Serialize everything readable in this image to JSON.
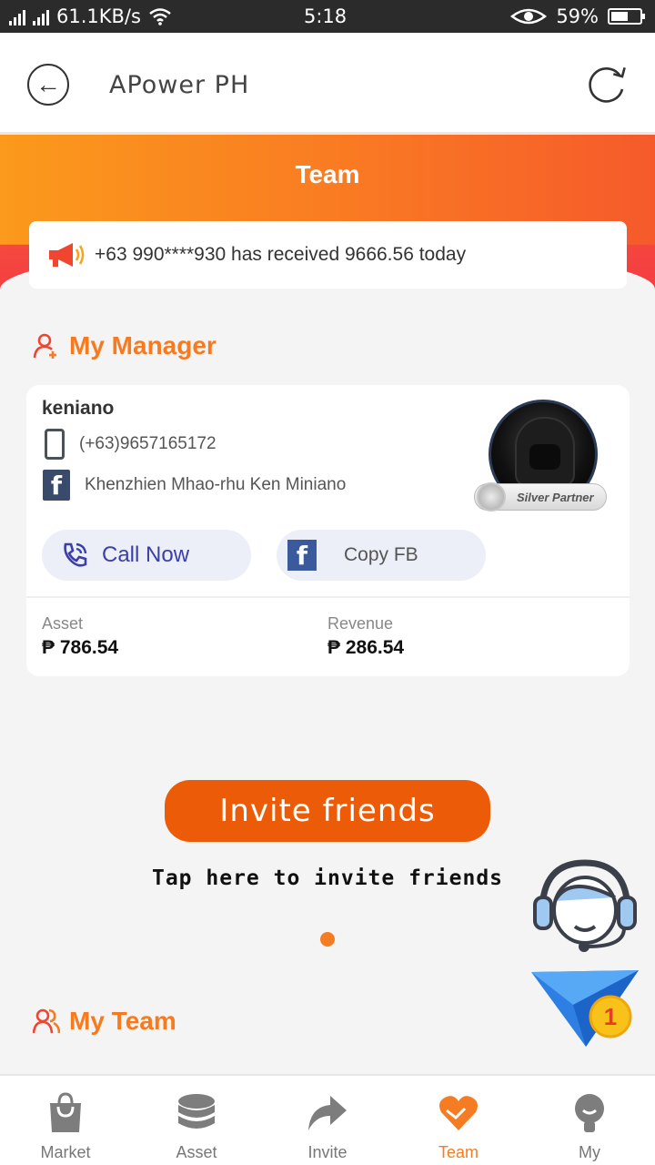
{
  "status_bar": {
    "network_speed": "61.1KB/s",
    "time": "5:18",
    "battery_percent": "59%",
    "battery_level": 0.59
  },
  "app_bar": {
    "title": "APower PH"
  },
  "header": {
    "title": "Team"
  },
  "notice": {
    "text": "+63 990****930 has received 9666.56 today"
  },
  "my_manager": {
    "section_title": "My Manager",
    "name": "keniano",
    "phone": "(+63)9657165172",
    "facebook_name": "Khenzhien Mhao-rhu Ken Miniano",
    "badge": "Silver Partner",
    "call_label": "Call Now",
    "copy_fb_label": "Copy FB",
    "asset_label": "Asset",
    "asset_value": "₱ 786.54",
    "revenue_label": "Revenue",
    "revenue_value": "₱ 286.54"
  },
  "invite": {
    "button_label": "Invite friends",
    "subtitle": "Tap here to invite friends"
  },
  "my_team": {
    "section_title": "My Team"
  },
  "floating": {
    "notification_count": "1"
  },
  "bottom_nav": {
    "items": [
      {
        "label": "Market",
        "icon": "bag-icon"
      },
      {
        "label": "Asset",
        "icon": "coins-icon"
      },
      {
        "label": "Invite",
        "icon": "share-arrow-icon"
      },
      {
        "label": "Team",
        "icon": "heart-hands-icon",
        "active": true
      },
      {
        "label": "My",
        "icon": "person-icon"
      }
    ]
  },
  "colors": {
    "accent": "#f57c22",
    "header_gradient_start": "#fb9a1c",
    "header_gradient_end": "#f65a2b",
    "invite_button": "#ec5b07",
    "call_text": "#3b3fa8"
  }
}
